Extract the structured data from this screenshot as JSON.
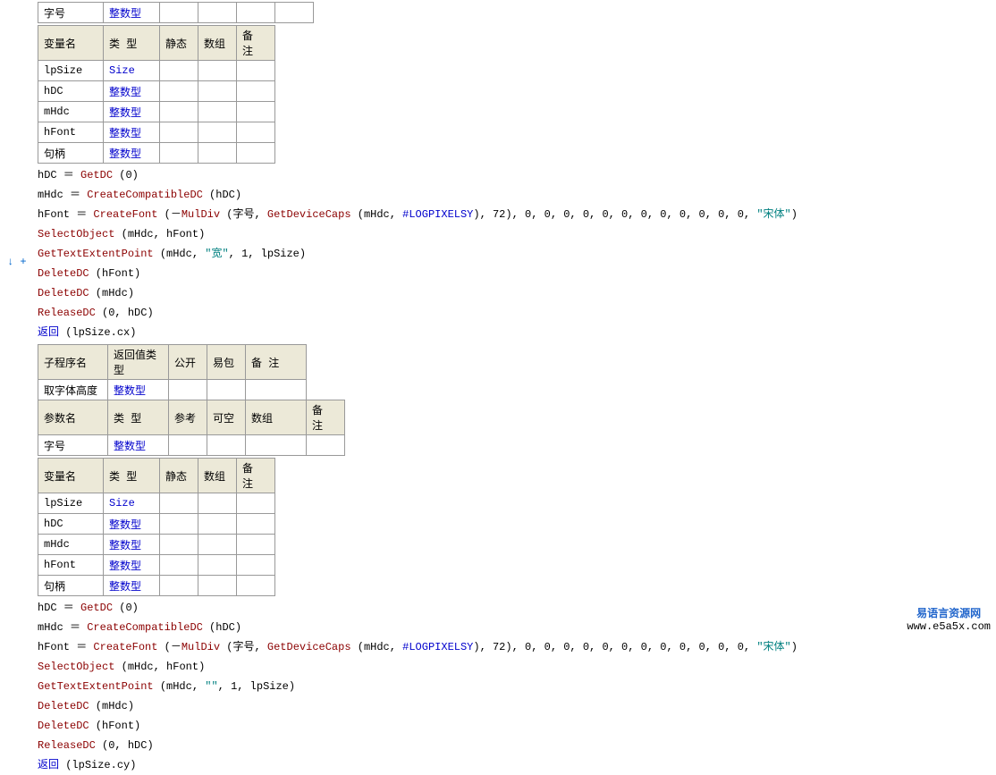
{
  "gutter": {
    "down": "↓",
    "plus": "+"
  },
  "hdr_var": {
    "name": "变量名",
    "type": "类 型",
    "static": "静态",
    "arr": "数组",
    "note": "备 注"
  },
  "hdr_sub": {
    "name": "子程序名",
    "ret": "返回值类型",
    "pub": "公开",
    "pkg": "易包",
    "note": "备 注"
  },
  "hdr_param": {
    "name": "参数名",
    "type": "类 型",
    "ref": "参考",
    "null": "可空",
    "arr": "数组",
    "note": "备 注"
  },
  "type_int": "整数型",
  "type_size": "Size",
  "row0": {
    "name": "字号"
  },
  "vars1": {
    "r0": "lpSize",
    "r1": "hDC",
    "r2": "mHdc",
    "r3": "hFont",
    "r4": "句柄"
  },
  "sub2": {
    "name": "取字体高度"
  },
  "param2": {
    "name": "字号"
  },
  "vars2": {
    "r0": "lpSize",
    "r1": "hDC",
    "r2": "mHdc",
    "r3": "hFont",
    "r4": "句柄"
  },
  "code": {
    "GetDC": "GetDC",
    "CreateCompatibleDC": "CreateCompatibleDC",
    "CreateFont": "CreateFont",
    "MulDiv": "MulDiv",
    "GetDeviceCaps": "GetDeviceCaps",
    "LOGPIXELSY": "#LOGPIXELSY",
    "SelectObject": "SelectObject",
    "GetTextExtentPoint": "GetTextExtentPoint",
    "DeleteDC": "DeleteDC",
    "ReleaseDC": "ReleaseDC",
    "return": "返回",
    "hDC": "hDC",
    "mHdc": "mHdc",
    "hFont": "hFont",
    "lpSize": "lpSize",
    "zihao": "字号",
    "songti": "\"宋体\"",
    "kuo": "\"宽\"",
    "empty": "\"\"",
    "zero": "0",
    "one": "1",
    "hyphen": "－",
    "n72": "72",
    "cx": "lpSize.cx",
    "cy": "lpSize.cy",
    "eq": " ＝ ",
    "neg": "－"
  },
  "watermark": {
    "title": "易语言资源网",
    "url": "www.e5a5x.com"
  }
}
